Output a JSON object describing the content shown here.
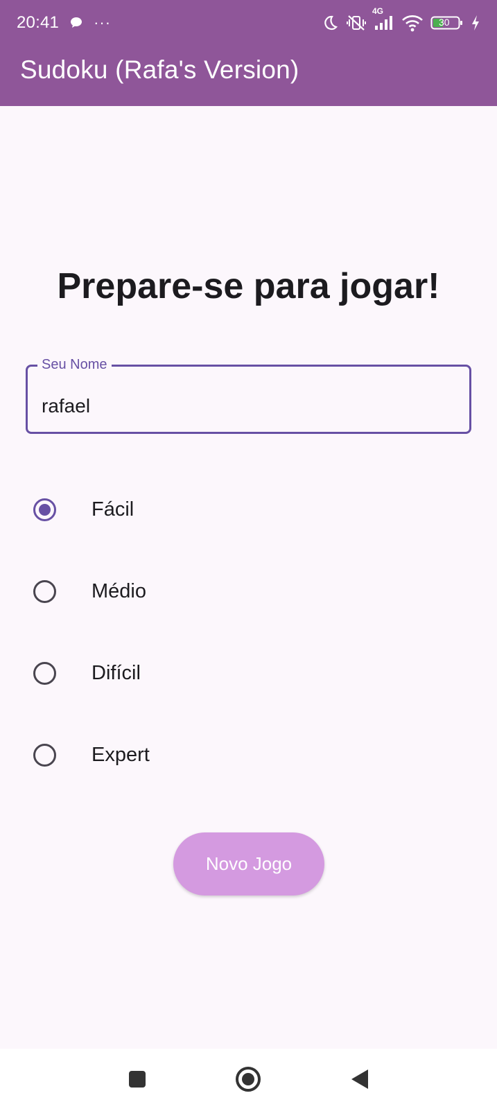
{
  "status_bar": {
    "time": "20:41",
    "more": "···",
    "network": "4G",
    "battery": "30"
  },
  "app_bar": {
    "title": "Sudoku (Rafa's Version)"
  },
  "main": {
    "headline": "Prepare-se para jogar!",
    "name_field": {
      "label": "Seu Nome",
      "value": "rafael"
    },
    "difficulty": {
      "selected": "Fácil",
      "options": [
        "Fácil",
        "Médio",
        "Difícil",
        "Expert"
      ]
    },
    "new_game_button": "Novo Jogo"
  },
  "colors": {
    "app_bar": "#8f5699",
    "background": "#fcf7fc",
    "primary": "#6750a4",
    "button": "#d49ae0"
  },
  "nav_bar": {
    "icons": [
      "recents-square-icon",
      "home-circle-icon",
      "back-triangle-icon"
    ]
  }
}
